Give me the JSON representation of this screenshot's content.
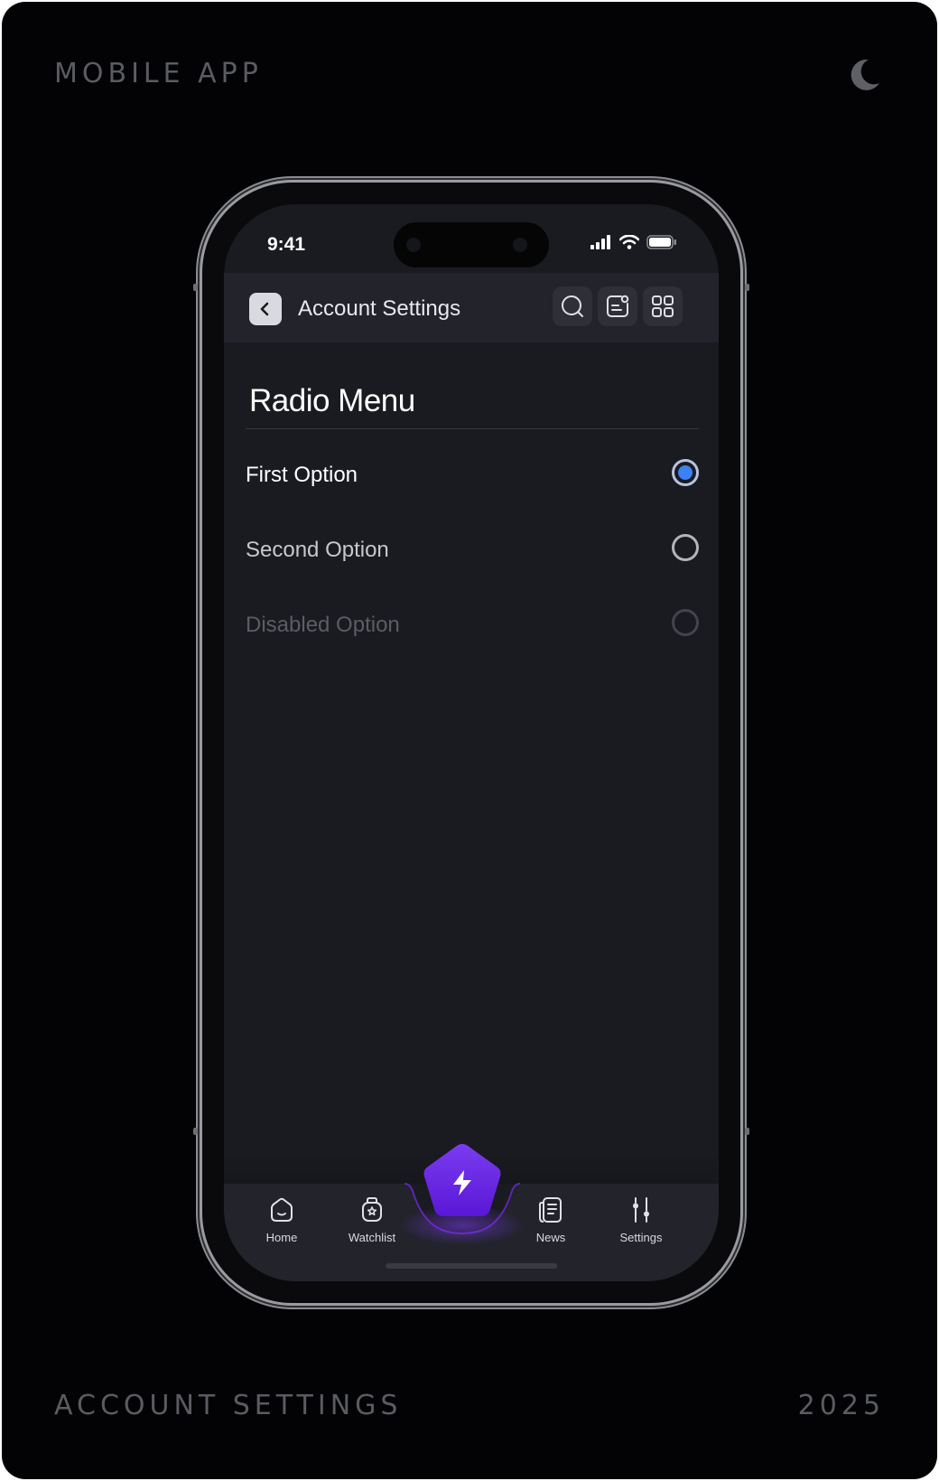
{
  "frame": {
    "top_left_label": "MOBILE APP",
    "bottom_left_label": "ACCOUNT SETTINGS",
    "bottom_right_label": "2025",
    "theme_icon": "moon-icon"
  },
  "status_bar": {
    "time": "9:41",
    "icons": [
      "signal-icon",
      "wifi-icon",
      "battery-icon"
    ]
  },
  "header": {
    "back_icon": "chevron-left-icon",
    "title": "Account Settings",
    "actions": [
      "search-icon",
      "note-icon",
      "grid-icon"
    ]
  },
  "page": {
    "title": "Radio Menu",
    "options": [
      {
        "label": "First Option",
        "state": "selected"
      },
      {
        "label": "Second Option",
        "state": "unselected"
      },
      {
        "label": "Disabled Option",
        "state": "disabled"
      }
    ]
  },
  "tabbar": {
    "tabs": [
      {
        "label": "Home",
        "icon": "home-icon"
      },
      {
        "label": "Watchlist",
        "icon": "watchlist-icon"
      },
      {
        "label": "News",
        "icon": "news-icon"
      },
      {
        "label": "Settings",
        "icon": "sliders-icon"
      }
    ],
    "center_action_icon": "lightning-icon"
  },
  "colors": {
    "accent": "#6d28d9",
    "radio_selected": "#3b82f6",
    "screen_bg": "#1a1b21"
  }
}
